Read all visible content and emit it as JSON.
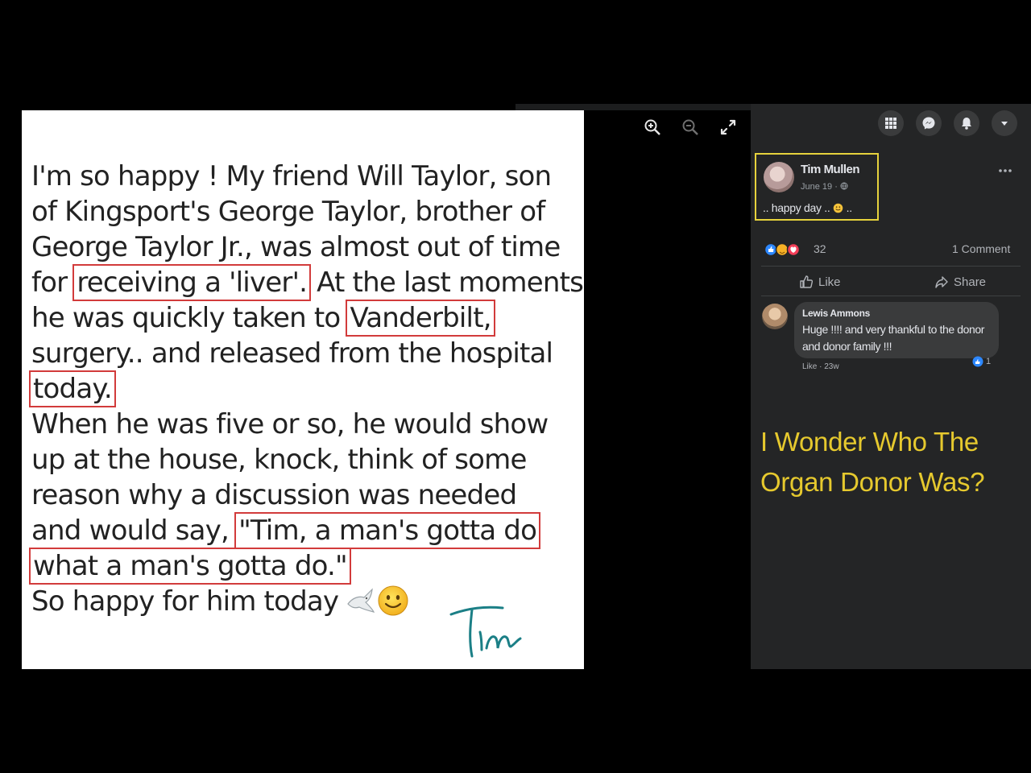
{
  "note": {
    "lines": [
      "I'm so happy !  My friend Will Taylor, son",
      "of Kingsport's George Taylor, brother of",
      "George Taylor Jr., was almost out of time",
      "for ",
      "receiving a 'liver'.",
      " At the last moments",
      "he was quickly taken to ",
      "Vanderbilt,",
      "surgery.. and released from the hospital",
      "today.",
      "When he was five or so, he would show",
      "up at the house, knock, think of some",
      "reason why a discussion was needed",
      "and would say, ",
      "\"Tim, a man's gotta do",
      "what a man's gotta do.\"",
      "So happy for him today"
    ],
    "signature": "Tim",
    "emoji_icons": [
      "dove-icon",
      "smiling-face-icon"
    ],
    "highlight_color": "#d23b3b"
  },
  "tools": {
    "zoom_in": "zoom-in-icon",
    "zoom_out": "zoom-out-icon",
    "fullscreen": "expand-icon"
  },
  "header_buttons": [
    "menu-grid-icon",
    "messenger-icon",
    "notifications-icon",
    "account-dropdown-icon"
  ],
  "post": {
    "author": "Tim Mullen",
    "date": "June 19 · ",
    "text": ".. happy day .. ",
    "text_end": " .."
  },
  "stats": {
    "reaction_count": "32",
    "comments_label": "1 Comment"
  },
  "actions": {
    "like": "Like",
    "share": "Share"
  },
  "comment": {
    "author": "Lewis Ammons",
    "text": "Huge !!!! and very thankful to the donor and donor family !!!",
    "meta": "Like · 23w",
    "like_count": "1"
  },
  "overlay_caption": {
    "line1": "I Wonder Who The",
    "line2": "Organ Donor Was?"
  },
  "colors": {
    "sidebar_bg": "#242526",
    "caption": "#e6c92e",
    "highlight_box": "#e6d23c",
    "signature": "#1b7f86"
  }
}
